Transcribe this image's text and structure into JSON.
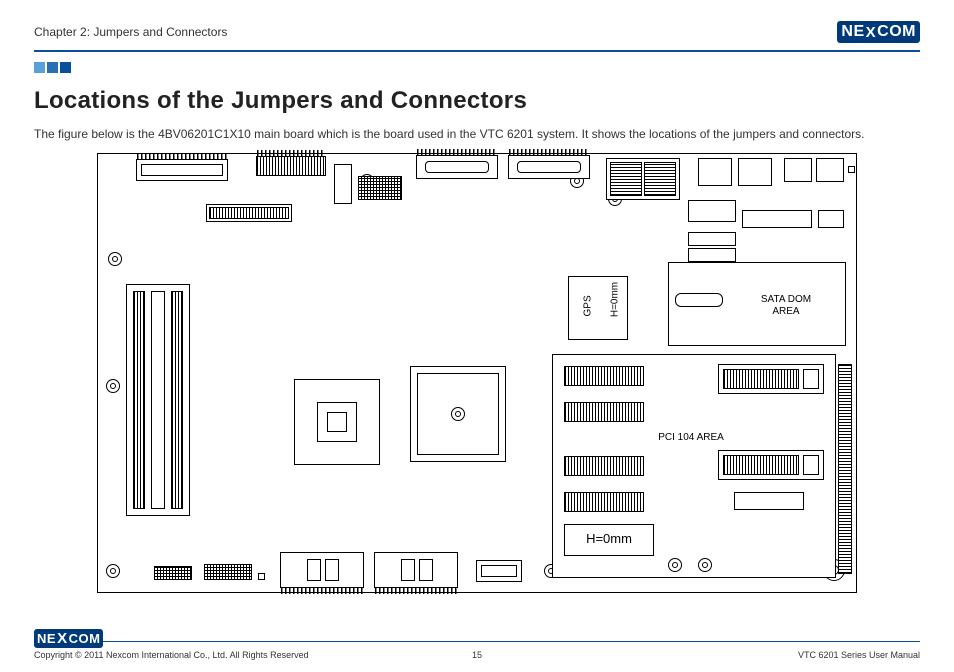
{
  "header": {
    "chapter": "Chapter 2: Jumpers and Connectors",
    "brand_left": "NE",
    "brand_x": "X",
    "brand_right": "COM"
  },
  "page": {
    "heading": "Locations of the Jumpers and Connectors",
    "intro": "The figure below is the 4BV06201C1X10 main board which is the board used in the VTC 6201 system. It shows the locations of the jumpers and connectors."
  },
  "board": {
    "gps_label_1": "GPS",
    "gps_label_2": "H=0mm",
    "sata_label_1": "SATA DOM",
    "sata_label_2": "AREA",
    "pci_label": "PCI 104 AREA",
    "h0_label": "H=0mm"
  },
  "footer": {
    "copyright": "Copyright © 2011 Nexcom International Co., Ltd. All Rights Reserved",
    "page_number": "15",
    "manual": "VTC 6201 Series User Manual"
  }
}
